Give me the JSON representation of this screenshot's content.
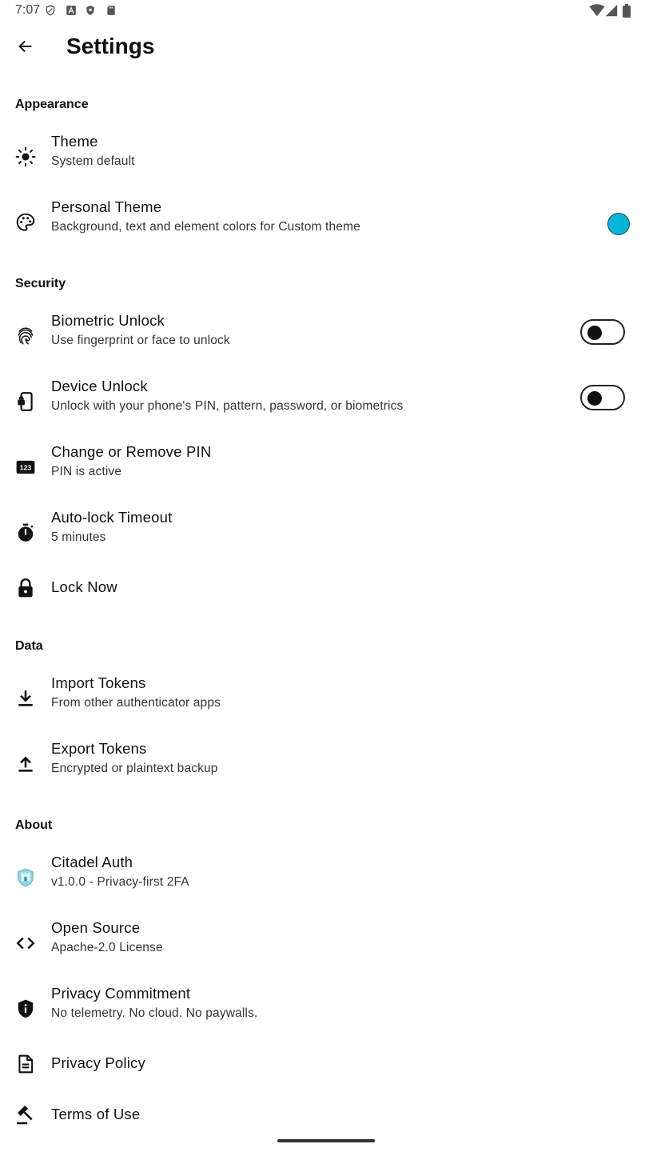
{
  "status_bar": {
    "time": "7:07",
    "left_icons": [
      "shield-outline-icon",
      "font-a-icon",
      "shield-filled-icon",
      "sd-card-icon"
    ],
    "right_icons": [
      "wifi-icon",
      "cellular-signal-icon",
      "battery-icon"
    ]
  },
  "header": {
    "title": "Settings",
    "back_icon": "arrow-back-icon"
  },
  "sections": {
    "appearance": {
      "label": "Appearance",
      "theme": {
        "title": "Theme",
        "subtitle": "System default",
        "icon": "sun-icon"
      },
      "personal_theme": {
        "title": "Personal Theme",
        "subtitle": "Background, text and element colors for Custom theme",
        "icon": "palette-icon",
        "swatch_color": "#05B4D6"
      }
    },
    "security": {
      "label": "Security",
      "biometric": {
        "title": "Biometric Unlock",
        "subtitle": "Use fingerprint or face to unlock",
        "icon": "fingerprint-icon",
        "enabled": false
      },
      "device_unlock": {
        "title": "Device Unlock",
        "subtitle": "Unlock with your phone's PIN, pattern, password, or biometrics",
        "icon": "phone-lock-icon",
        "enabled": false
      },
      "pin": {
        "title": "Change or Remove PIN",
        "subtitle": "PIN is active",
        "icon": "pin-123-icon",
        "icon_text": "123"
      },
      "autolock": {
        "title": "Auto-lock Timeout",
        "subtitle": "5 minutes",
        "icon": "timer-icon"
      },
      "lock_now": {
        "title": "Lock Now",
        "icon": "lock-icon"
      }
    },
    "data": {
      "label": "Data",
      "import": {
        "title": "Import Tokens",
        "subtitle": "From other authenticator apps",
        "icon": "download-icon"
      },
      "export": {
        "title": "Export Tokens",
        "subtitle": "Encrypted or plaintext backup",
        "icon": "upload-icon"
      }
    },
    "about": {
      "label": "About",
      "app": {
        "title": "Citadel Auth",
        "subtitle": "v1.0.0 - Privacy-first 2FA",
        "icon": "citadel-logo-icon"
      },
      "open_source": {
        "title": "Open Source",
        "subtitle": "Apache-2.0 License",
        "icon": "code-icon"
      },
      "privacy_commitment": {
        "title": "Privacy Commitment",
        "subtitle": "No telemetry. No cloud. No paywalls.",
        "icon": "shield-info-icon"
      },
      "privacy_policy": {
        "title": "Privacy Policy",
        "icon": "document-icon"
      },
      "terms": {
        "title": "Terms of Use",
        "icon": "gavel-icon"
      }
    }
  },
  "colors": {
    "background": "#FFFFFF",
    "text_primary": "#111111",
    "text_secondary": "#333333",
    "accent_swatch": "#05B4D6"
  }
}
